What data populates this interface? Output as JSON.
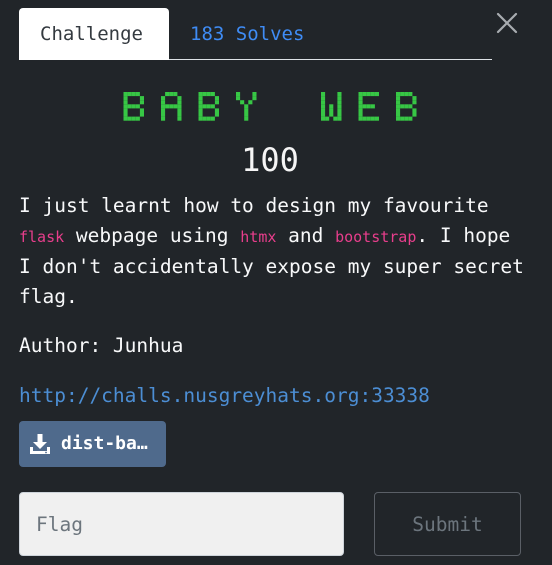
{
  "tabs": [
    {
      "label": "Challenge",
      "active": true
    },
    {
      "label": "183 Solves",
      "active": false
    }
  ],
  "challenge": {
    "name": "BABY WEB",
    "points": "100",
    "description": {
      "part1": "I just learnt how to design my favourite ",
      "code1": "flask",
      "part2": " webpage using ",
      "code2": "htmx",
      "part3": " and ",
      "code3": "bootstrap",
      "part4": ". I hope I don't accidentally expose my super secret flag."
    },
    "author": "Author: Junhua",
    "link": "http://challs.nusgreyhats.org:33338",
    "download_label": "dist-ba…"
  },
  "form": {
    "flag_placeholder": "Flag",
    "flag_value": "",
    "submit_label": "Submit"
  },
  "colors": {
    "background": "#212529",
    "title": "#37c745",
    "solves_tab": "#3f8cf5",
    "code": "#e83e8c",
    "link": "#4c8ed4",
    "download_button": "#4f6a8c"
  },
  "icons": {
    "close": "close-icon",
    "download": "download-icon"
  }
}
